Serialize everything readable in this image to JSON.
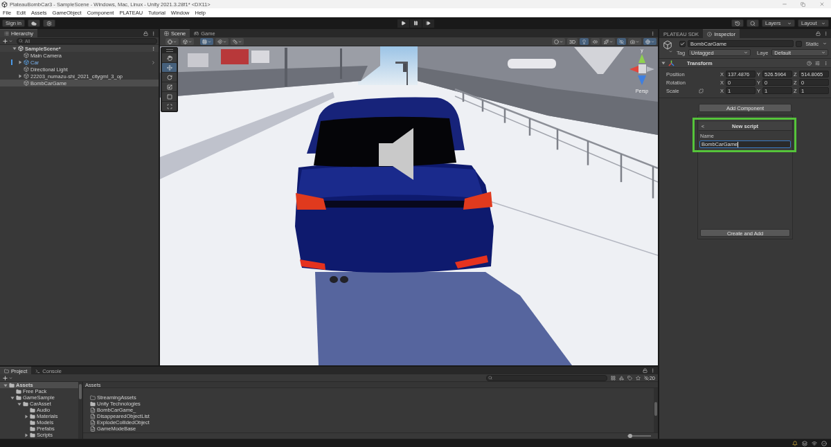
{
  "window": {
    "title": "PlateauBombCar3 - SampleScene - Windows, Mac, Linux - Unity 2021.3.28f1* <DX11>"
  },
  "menu_bar": [
    "File",
    "Edit",
    "Assets",
    "GameObject",
    "Component",
    "PLATEAU",
    "Tutorial",
    "Window",
    "Help"
  ],
  "toolbar": {
    "sign_in": "Sign in",
    "layers": "Layers",
    "layout": "Layout"
  },
  "hierarchy": {
    "tabs": [
      {
        "label": "Hierarchy",
        "selected": true
      }
    ],
    "search": {
      "placeholder": "All"
    },
    "items": [
      {
        "label": "SampleScene*",
        "kind": "scene",
        "selected": false,
        "expanded": true,
        "children": [
          {
            "label": "Main Camera",
            "kind": "object",
            "selected": false
          },
          {
            "label": "Car",
            "kind": "prefab",
            "selected": false,
            "expanded": false
          },
          {
            "label": "Directional Light",
            "kind": "object",
            "selected": false
          },
          {
            "label": "22203_numazu-shi_2021_citygml_3_op",
            "kind": "object",
            "selected": false,
            "expanded": false
          },
          {
            "label": "BombCarGame",
            "kind": "object",
            "selected": true
          }
        ]
      }
    ]
  },
  "scene_view": {
    "tabs": [
      {
        "label": "Scene",
        "kind": "scene",
        "selected": true
      },
      {
        "label": "Game",
        "kind": "game",
        "selected": false
      }
    ],
    "toolbar_left": [
      {
        "kind": "handle-position",
        "on": false
      },
      {
        "kind": "pivot-rotation",
        "on": false
      },
      {
        "kind": "grid",
        "on": true
      },
      {
        "kind": "snap",
        "on": false
      },
      {
        "kind": "increment",
        "on": false
      }
    ],
    "toolbar_right": [
      {
        "kind": "draw-mode",
        "on": false
      },
      {
        "kind": "text",
        "label": "3D",
        "on": false
      },
      {
        "kind": "lighting",
        "on": true
      },
      {
        "kind": "audio",
        "on": false
      },
      {
        "kind": "effects",
        "on": false
      },
      {
        "kind": "visibility",
        "on": true
      },
      {
        "kind": "camera",
        "on": false
      },
      {
        "kind": "gizmos",
        "on": true
      }
    ],
    "tools": [
      {
        "kind": "hand",
        "selected": false
      },
      {
        "kind": "move",
        "selected": true
      },
      {
        "kind": "rotate",
        "selected": false
      },
      {
        "kind": "scale",
        "selected": false
      },
      {
        "kind": "rect",
        "selected": false
      },
      {
        "kind": "transform",
        "selected": false
      }
    ],
    "gizmo_axis_label": "y",
    "camera_label": "Persp"
  },
  "inspector": {
    "tabs": [
      {
        "label": "PLATEAU SDK",
        "kind": "plateau",
        "selected": false
      },
      {
        "label": "Inspector",
        "kind": "inspector",
        "selected": true
      }
    ],
    "object": {
      "active": true,
      "name": "BombCarGame",
      "static": false,
      "static_label": "Static",
      "tag_label": "Tag",
      "tag": "Untagged",
      "layer_label": "Laye",
      "layer": "Default"
    },
    "transform": {
      "title": "Transform",
      "expanded": true,
      "rows": [
        {
          "label": "Position",
          "kind": "position",
          "fields": [
            {
              "axis": "X",
              "value": "137.4876"
            },
            {
              "axis": "Y",
              "value": "526.5964"
            },
            {
              "axis": "Z",
              "value": "514.8065"
            }
          ]
        },
        {
          "label": "Rotation",
          "kind": "rotation",
          "fields": [
            {
              "axis": "X",
              "value": "0"
            },
            {
              "axis": "Y",
              "value": "0"
            },
            {
              "axis": "Z",
              "value": "0"
            }
          ]
        },
        {
          "label": "Scale",
          "kind": "scale",
          "fields": [
            {
              "axis": "X",
              "value": "1"
            },
            {
              "axis": "Y",
              "value": "1"
            },
            {
              "axis": "Z",
              "value": "1"
            }
          ]
        }
      ]
    },
    "add_component": "Add Component",
    "new_script": {
      "back": "<",
      "title": "New script",
      "name_label": "Name",
      "name_value": "BombCarGame",
      "create_button": "Create and Add"
    }
  },
  "project": {
    "tabs": [
      {
        "label": "Project",
        "kind": "project",
        "selected": true
      },
      {
        "label": "Console",
        "kind": "console",
        "selected": false
      }
    ],
    "hidden_count": "20",
    "folders": [
      {
        "label": "Assets",
        "selected": true,
        "expanded": true,
        "children": [
          {
            "label": "Free Pack",
            "selected": false
          },
          {
            "label": "GameSample",
            "selected": false,
            "expanded": true,
            "children": [
              {
                "label": "CarAsset",
                "selected": false,
                "expanded": true,
                "children": [
                  {
                    "label": "Audio",
                    "selected": false
                  },
                  {
                    "label": "Materials",
                    "selected": false,
                    "expanded": false
                  },
                  {
                    "label": "Models",
                    "selected": false
                  },
                  {
                    "label": "Prefabs",
                    "selected": false
                  },
                  {
                    "label": "Scripts",
                    "selected": false,
                    "expanded": false
                  }
                ]
              }
            ]
          }
        ]
      }
    ],
    "path": "Assets",
    "items": [
      {
        "label": "StreamingAssets",
        "kind": "empty-folder",
        "selected": false
      },
      {
        "label": "Unity Technologies",
        "kind": "folder",
        "selected": false
      },
      {
        "label": "BombCarGame_",
        "kind": "script",
        "selected": false
      },
      {
        "label": "DisappearedObjectList",
        "kind": "script",
        "selected": false
      },
      {
        "label": "ExplodeCollidedObject",
        "kind": "script",
        "selected": false
      },
      {
        "label": "GameModeBase",
        "kind": "script",
        "selected": false
      }
    ],
    "icon_size": {
      "level": 0.12
    }
  }
}
